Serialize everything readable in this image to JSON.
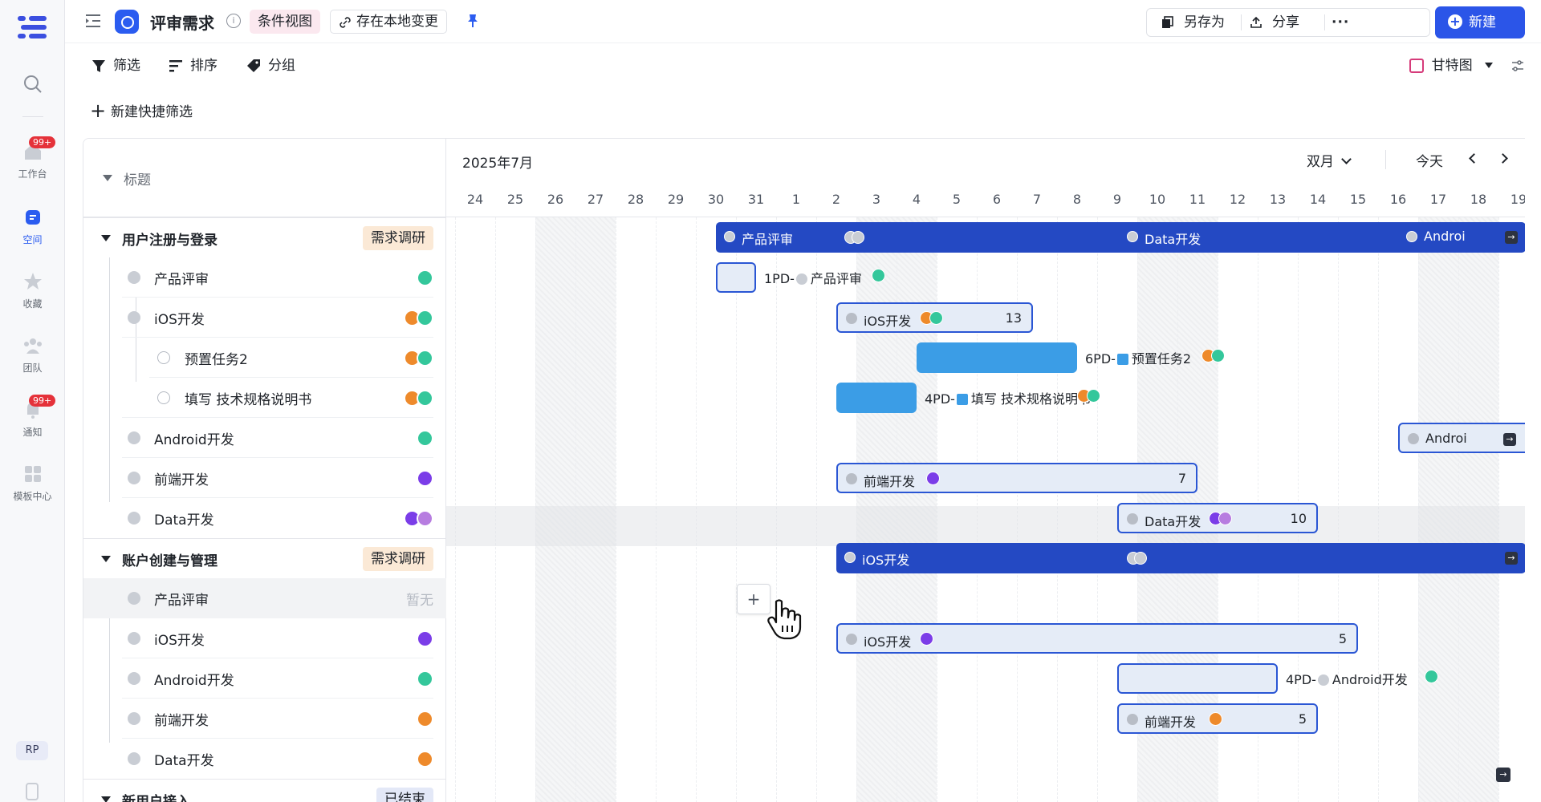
{
  "rail": {
    "items": [
      {
        "label": "",
        "icon": "search-icon"
      },
      {
        "label": "工作台",
        "icon": "home-icon",
        "badge": "99+"
      },
      {
        "label": "空间",
        "icon": "space-icon"
      },
      {
        "label": "收藏",
        "icon": "star-icon"
      },
      {
        "label": "团队",
        "icon": "team-icon"
      },
      {
        "label": "通知",
        "icon": "bell-icon",
        "badge": "99+"
      },
      {
        "label": "模板中心",
        "icon": "template-icon"
      }
    ],
    "user_initials": "RP"
  },
  "header": {
    "title": "评审需求",
    "view_chip": "条件视图",
    "save_chip": "存在本地变更",
    "save_as": "另存为",
    "share": "分享",
    "more": "···",
    "new_button": "新建"
  },
  "toolbar": {
    "filter": "筛选",
    "sort": "排序",
    "group": "分组",
    "view_switch": "甘特图",
    "quick_filter": "新建快捷筛选"
  },
  "tree": {
    "header": "标题",
    "groups": [
      {
        "title": "用户注册与登录",
        "status": "需求调研"
      },
      {
        "title": "账户创建与管理",
        "status": "需求调研"
      },
      {
        "title": "新用户接入",
        "status": "已结束"
      }
    ],
    "rows": [
      {
        "title": "产品评审"
      },
      {
        "title": "iOS开发"
      },
      {
        "title": "预置任务2"
      },
      {
        "title": "填写 技术规格说明书"
      },
      {
        "title": "Android开发"
      },
      {
        "title": "前端开发"
      },
      {
        "title": "Data开发"
      },
      {
        "title": "产品评审",
        "note": "暂无"
      },
      {
        "title": "iOS开发"
      },
      {
        "title": "Android开发"
      },
      {
        "title": "前端开发"
      },
      {
        "title": "Data开发"
      }
    ]
  },
  "timeline": {
    "month": "2025年7月",
    "scale": "双月",
    "today": "今天",
    "days": [
      "24",
      "25",
      "26",
      "27",
      "28",
      "29",
      "30",
      "31",
      "1",
      "2",
      "3",
      "4",
      "5",
      "6",
      "7",
      "8",
      "9",
      "10",
      "11",
      "12",
      "13",
      "14",
      "15",
      "16",
      "17",
      "18",
      "19"
    ],
    "bars": {
      "g1_a": "产品评审",
      "g1_b": "Data开发",
      "g1_c": "Androi",
      "r_pr_ext": "1PD-",
      "r_pr_ext_label": "产品评审",
      "r_ios": "iOS开发",
      "r_ios_num": "13",
      "r_pre_ext": "6PD-",
      "r_pre_label": "预置任务2",
      "r_spec_ext": "4PD-",
      "r_spec_label": "填写 技术规格说明书",
      "r_and": "Androi",
      "r_fe": "前端开发",
      "r_fe_num": "7",
      "r_data": "Data开发",
      "r_data_num": "10",
      "g2_a": "iOS开发",
      "r2_ios": "iOS开发",
      "r2_ios_num": "5",
      "r2_and_ext": "4PD-",
      "r2_and_label": "Android开发",
      "r2_fe": "前端开发",
      "r2_fe_num": "5"
    },
    "add_button": "+"
  },
  "colors": {
    "accent": "#2b55e8",
    "summary_bar": "#2449c3",
    "task_fill": "#e5ecf7",
    "solid_bar": "#3b9de6"
  }
}
